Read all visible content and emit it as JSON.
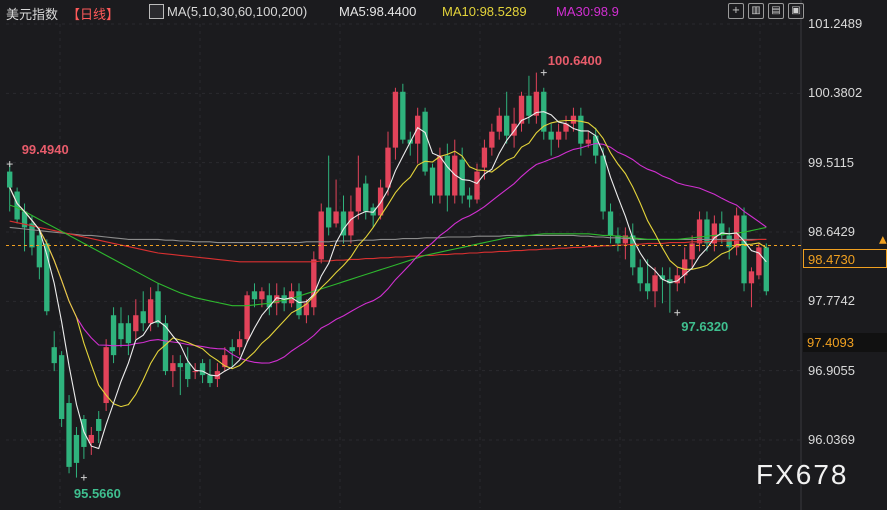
{
  "header": {
    "symbol": "美元指数",
    "period": "【日线】",
    "ma_label": "MA(5,10,30,60,100,200)",
    "ma5": "MA5:98.4400",
    "ma10": "MA10:98.5289",
    "ma30": "MA30:98.9",
    "colors": {
      "ma5": "#e6e6e6",
      "ma10": "#e3d33a",
      "ma30": "#d12fd1",
      "period": "#ff5a5a"
    }
  },
  "toolbar": {
    "icons": [
      "crosshair-icon",
      "chart-type-icon",
      "indicator-icon",
      "settings-icon"
    ]
  },
  "watermark": "FX678",
  "chart_data": {
    "type": "candlestick",
    "ylim": [
      95.55,
      101.25
    ],
    "y_ticks": [
      "101.2489",
      "100.3802",
      "99.5115",
      "98.6429",
      "97.7742",
      "96.9055",
      "96.0369"
    ],
    "y_tick_values": [
      101.2489,
      100.3802,
      99.5115,
      98.6429,
      97.7742,
      96.9055,
      96.0369
    ],
    "current_price": "98.4730",
    "highlight_price": "97.4093",
    "annotations": [
      {
        "text": "99.4940",
        "value": 99.494,
        "bar": 0,
        "color": "#e85c6b"
      },
      {
        "text": "95.5660",
        "value": 95.566,
        "bar": 10,
        "color": "#3fbf8f"
      },
      {
        "text": "100.6400",
        "value": 100.64,
        "bar": 72,
        "color": "#e85c6b"
      },
      {
        "text": "97.6320",
        "value": 97.632,
        "bar": 90,
        "color": "#3fbf8f"
      }
    ],
    "candles": [
      [
        99.4,
        99.2,
        99.49,
        98.9
      ],
      [
        99.15,
        98.8,
        99.2,
        98.75
      ],
      [
        98.9,
        98.7,
        99.0,
        98.4
      ],
      [
        98.75,
        98.45,
        98.85,
        98.35
      ],
      [
        98.6,
        98.2,
        98.7,
        98.05
      ],
      [
        98.5,
        97.65,
        98.55,
        97.6
      ],
      [
        97.2,
        97.0,
        97.4,
        96.9
      ],
      [
        97.1,
        96.3,
        97.15,
        96.2
      ],
      [
        96.5,
        95.7,
        96.6,
        95.62
      ],
      [
        96.1,
        95.75,
        96.2,
        95.566
      ],
      [
        96.3,
        95.95,
        96.35,
        95.8
      ],
      [
        96.0,
        96.1,
        96.2,
        95.85
      ],
      [
        96.3,
        96.15,
        96.4,
        96.0
      ],
      [
        96.5,
        97.2,
        97.3,
        96.4
      ],
      [
        97.6,
        97.1,
        97.7,
        97.0
      ],
      [
        97.5,
        97.3,
        97.7,
        97.2
      ],
      [
        97.5,
        97.25,
        97.6,
        97.1
      ],
      [
        97.4,
        97.6,
        97.8,
        97.3
      ],
      [
        97.65,
        97.5,
        97.9,
        97.4
      ],
      [
        97.5,
        97.8,
        97.95,
        97.4
      ],
      [
        97.9,
        97.5,
        98.0,
        97.45
      ],
      [
        97.5,
        96.9,
        97.6,
        96.85
      ],
      [
        96.9,
        97.0,
        97.1,
        96.7
      ],
      [
        97.0,
        96.95,
        97.1,
        96.6
      ],
      [
        97.0,
        96.8,
        97.2,
        96.7
      ],
      [
        96.9,
        96.9,
        97.0,
        96.8
      ],
      [
        97.0,
        96.85,
        97.05,
        96.75
      ],
      [
        96.85,
        96.75,
        97.05,
        96.7
      ],
      [
        96.8,
        96.9,
        97.0,
        96.7
      ],
      [
        96.95,
        97.1,
        97.2,
        96.9
      ],
      [
        97.2,
        97.15,
        97.3,
        96.95
      ],
      [
        97.2,
        97.3,
        97.4,
        97.1
      ],
      [
        97.3,
        97.85,
        97.9,
        97.25
      ],
      [
        97.9,
        97.8,
        98.0,
        97.7
      ],
      [
        97.8,
        97.9,
        97.95,
        97.7
      ],
      [
        97.85,
        97.7,
        98.0,
        97.6
      ],
      [
        97.75,
        97.85,
        98.0,
        97.6
      ],
      [
        97.85,
        97.75,
        97.95,
        97.65
      ],
      [
        97.75,
        97.9,
        98.0,
        97.7
      ],
      [
        97.9,
        97.6,
        98.0,
        97.55
      ],
      [
        97.6,
        97.75,
        97.8,
        97.5
      ],
      [
        97.7,
        98.3,
        98.4,
        97.6
      ],
      [
        98.3,
        98.9,
        99.0,
        98.25
      ],
      [
        98.95,
        98.7,
        99.6,
        98.6
      ],
      [
        98.75,
        98.9,
        99.3,
        98.7
      ],
      [
        98.9,
        98.6,
        99.1,
        98.5
      ],
      [
        98.6,
        98.9,
        99.1,
        98.5
      ],
      [
        98.9,
        99.2,
        99.6,
        98.8
      ],
      [
        99.25,
        98.9,
        99.35,
        98.8
      ],
      [
        98.95,
        98.85,
        99.0,
        98.7
      ],
      [
        98.85,
        99.2,
        99.3,
        98.8
      ],
      [
        99.2,
        99.7,
        99.9,
        99.1
      ],
      [
        99.7,
        100.4,
        100.45,
        99.55
      ],
      [
        100.4,
        99.8,
        100.5,
        99.75
      ],
      [
        99.8,
        99.75,
        99.9,
        99.6
      ],
      [
        99.75,
        100.1,
        100.2,
        99.5
      ],
      [
        100.15,
        99.4,
        100.2,
        99.35
      ],
      [
        99.45,
        99.1,
        99.5,
        99.0
      ],
      [
        99.1,
        99.6,
        99.7,
        99.0
      ],
      [
        99.6,
        99.1,
        99.75,
        98.9
      ],
      [
        99.1,
        99.6,
        99.8,
        99.0
      ],
      [
        99.55,
        99.1,
        99.7,
        99.0
      ],
      [
        99.1,
        99.05,
        99.2,
        98.95
      ],
      [
        99.05,
        99.4,
        99.5,
        99.0
      ],
      [
        99.45,
        99.7,
        99.8,
        99.3
      ],
      [
        99.7,
        99.9,
        100.0,
        99.6
      ],
      [
        99.9,
        100.1,
        100.2,
        99.8
      ],
      [
        100.1,
        99.85,
        100.4,
        99.75
      ],
      [
        99.85,
        100.0,
        100.2,
        99.7
      ],
      [
        100.0,
        100.35,
        100.4,
        99.9
      ],
      [
        100.35,
        100.1,
        100.6,
        100.0
      ],
      [
        100.1,
        100.4,
        100.64,
        100.0
      ],
      [
        100.4,
        99.9,
        100.45,
        99.8
      ],
      [
        99.9,
        99.8,
        100.0,
        99.6
      ],
      [
        99.8,
        99.9,
        100.0,
        99.7
      ],
      [
        99.9,
        100.0,
        100.1,
        99.8
      ],
      [
        100.0,
        100.1,
        100.2,
        99.9
      ],
      [
        100.1,
        99.75,
        100.2,
        99.6
      ],
      [
        99.75,
        99.8,
        99.9,
        99.7
      ],
      [
        99.85,
        99.6,
        99.95,
        99.5
      ],
      [
        99.6,
        98.9,
        99.7,
        98.8
      ],
      [
        98.9,
        98.6,
        99.0,
        98.5
      ],
      [
        98.6,
        98.5,
        98.7,
        98.4
      ],
      [
        98.5,
        98.6,
        98.7,
        98.3
      ],
      [
        98.6,
        98.2,
        98.75,
        98.1
      ],
      [
        98.2,
        98.0,
        98.3,
        97.9
      ],
      [
        98.0,
        97.9,
        98.3,
        97.8
      ],
      [
        97.9,
        98.1,
        98.2,
        97.7
      ],
      [
        98.1,
        98.05,
        98.2,
        97.75
      ],
      [
        98.05,
        98.0,
        98.2,
        97.632
      ],
      [
        98.0,
        98.1,
        98.2,
        97.9
      ],
      [
        98.1,
        98.3,
        98.45,
        98.0
      ],
      [
        98.3,
        98.5,
        98.6,
        98.2
      ],
      [
        98.5,
        98.8,
        98.9,
        98.4
      ],
      [
        98.8,
        98.5,
        98.9,
        98.4
      ],
      [
        98.5,
        98.75,
        98.85,
        98.4
      ],
      [
        98.75,
        98.6,
        98.9,
        98.5
      ],
      [
        98.6,
        98.45,
        98.7,
        98.3
      ],
      [
        98.45,
        98.85,
        98.95,
        98.35
      ],
      [
        98.85,
        98.0,
        98.95,
        97.9
      ],
      [
        98.0,
        98.15,
        98.2,
        97.7
      ],
      [
        98.1,
        98.45,
        98.5,
        98.05
      ],
      [
        98.45,
        97.9,
        98.5,
        97.85
      ]
    ],
    "ma_series": [
      {
        "name": "MA5",
        "color": "#ededed",
        "period": 5
      },
      {
        "name": "MA10",
        "color": "#e3d33a",
        "period": 10
      },
      {
        "name": "MA30",
        "color": "#d12fd1",
        "period": 30
      },
      {
        "name": "MA60",
        "color": "#2eb82e",
        "period": 60
      },
      {
        "name": "MA100",
        "color": "#8c8c8c",
        "period": 100
      },
      {
        "name": "MA200",
        "color": "#d93030",
        "period": 200
      }
    ],
    "ma_long_values": {
      "MA60": [
        98.98,
        98.95,
        98.9,
        98.85,
        98.8,
        98.75,
        98.7,
        98.65,
        98.6,
        98.55,
        98.5,
        98.45,
        98.4,
        98.35,
        98.3,
        98.25,
        98.2,
        98.15,
        98.1,
        98.05,
        98.0,
        97.96,
        97.92,
        97.88,
        97.85,
        97.82,
        97.8,
        97.78,
        97.76,
        97.74,
        97.72,
        97.72,
        97.72,
        97.73,
        97.74,
        97.75,
        97.77,
        97.79,
        97.81,
        97.84,
        97.87,
        97.9,
        97.93,
        97.96,
        97.99,
        98.02,
        98.05,
        98.08,
        98.11,
        98.14,
        98.17,
        98.2,
        98.23,
        98.26,
        98.29,
        98.32,
        98.35,
        98.37,
        98.39,
        98.41,
        98.43,
        98.45,
        98.47,
        98.49,
        98.51,
        98.53,
        98.55,
        98.57,
        98.58,
        98.59,
        98.6,
        98.61,
        98.62,
        98.62,
        98.62,
        98.62,
        98.62,
        98.62,
        98.62,
        98.61,
        98.6,
        98.6,
        98.59,
        98.58,
        98.57,
        98.56,
        98.55,
        98.55,
        98.55,
        98.55,
        98.55,
        98.56,
        98.57,
        98.58,
        98.59,
        98.6,
        98.61,
        98.62,
        98.63,
        98.64,
        98.66,
        98.68,
        98.7
      ],
      "MA100": [
        98.7,
        98.69,
        98.68,
        98.67,
        98.66,
        98.65,
        98.64,
        98.63,
        98.62,
        98.61,
        98.6,
        98.6,
        98.59,
        98.58,
        98.57,
        98.56,
        98.55,
        98.55,
        98.55,
        98.55,
        98.55,
        98.54,
        98.54,
        98.53,
        98.53,
        98.52,
        98.52,
        98.52,
        98.51,
        98.51,
        98.51,
        98.51,
        98.51,
        98.51,
        98.51,
        98.51,
        98.51,
        98.51,
        98.51,
        98.51,
        98.52,
        98.52,
        98.52,
        98.52,
        98.53,
        98.53,
        98.53,
        98.54,
        98.54,
        98.54,
        98.55,
        98.55,
        98.55,
        98.56,
        98.56,
        98.56,
        98.57,
        98.57,
        98.57,
        98.58,
        98.58,
        98.58,
        98.58,
        98.59,
        98.59,
        98.59,
        98.59,
        98.6,
        98.6,
        98.6,
        98.6,
        98.6,
        98.6,
        98.6,
        98.6,
        98.6,
        98.6,
        98.59,
        98.59,
        98.58,
        98.58,
        98.57,
        98.57,
        98.56,
        98.56,
        98.55,
        98.55,
        98.55,
        98.55,
        98.55,
        98.55,
        98.55,
        98.55,
        98.55,
        98.55,
        98.55,
        98.55,
        98.55,
        98.55,
        98.55,
        98.55,
        98.55,
        98.55
      ],
      "MA200": [
        98.78,
        98.76,
        98.74,
        98.72,
        98.7,
        98.68,
        98.66,
        98.64,
        98.62,
        98.6,
        98.58,
        98.56,
        98.54,
        98.52,
        98.5,
        98.48,
        98.46,
        98.44,
        98.42,
        98.4,
        98.38,
        98.37,
        98.36,
        98.35,
        98.34,
        98.33,
        98.32,
        98.31,
        98.3,
        98.29,
        98.28,
        98.27,
        98.27,
        98.27,
        98.27,
        98.27,
        98.27,
        98.27,
        98.27,
        98.27,
        98.27,
        98.27,
        98.28,
        98.28,
        98.29,
        98.29,
        98.3,
        98.3,
        98.31,
        98.31,
        98.32,
        98.32,
        98.33,
        98.33,
        98.34,
        98.34,
        98.35,
        98.35,
        98.36,
        98.36,
        98.37,
        98.37,
        98.38,
        98.38,
        98.39,
        98.39,
        98.4,
        98.4,
        98.41,
        98.41,
        98.42,
        98.42,
        98.43,
        98.43,
        98.44,
        98.44,
        98.45,
        98.45,
        98.46,
        98.46,
        98.47,
        98.47,
        98.48,
        98.48,
        98.49,
        98.49,
        98.5,
        98.5,
        98.5,
        98.51,
        98.51,
        98.51,
        98.52,
        98.52,
        98.52,
        98.53,
        98.53,
        98.53,
        98.54,
        98.54,
        98.54,
        98.55,
        98.55
      ]
    }
  }
}
